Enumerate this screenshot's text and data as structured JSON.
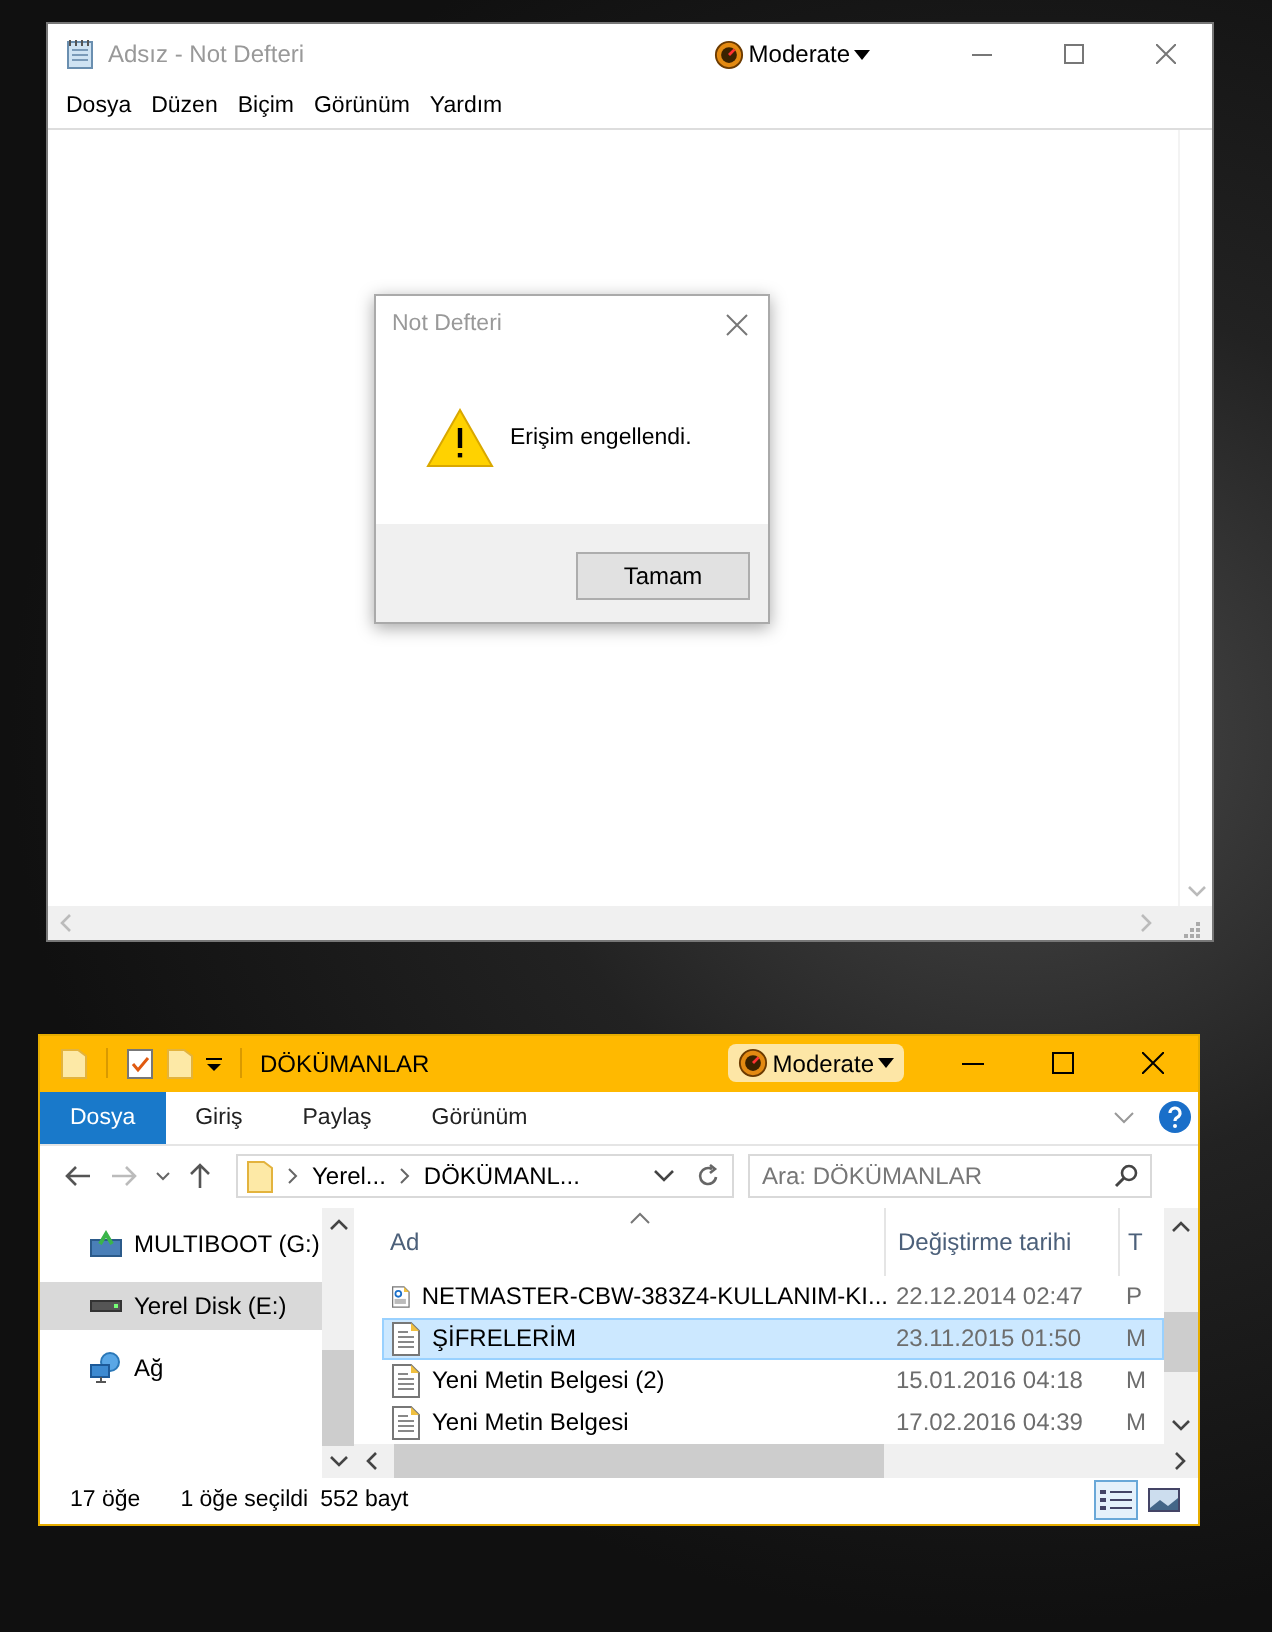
{
  "notepad": {
    "title": "Adsız - Not Defteri",
    "badge": "Moderate",
    "menu": [
      "Dosya",
      "Düzen",
      "Biçim",
      "Görünüm",
      "Yardım"
    ]
  },
  "dialog": {
    "title": "Not Defteri",
    "message": "Erişim engellendi.",
    "button": "Tamam"
  },
  "explorer": {
    "title": "DÖKÜMANLAR",
    "badge": "Moderate",
    "tabs": [
      {
        "label": "Dosya",
        "selected": true
      },
      {
        "label": "Giriş",
        "selected": false
      },
      {
        "label": "Paylaş",
        "selected": false
      },
      {
        "label": "Görünüm",
        "selected": false
      }
    ],
    "breadcrumb": [
      "Yerel...",
      "DÖKÜMANL..."
    ],
    "search": {
      "placeholder": "Ara: DÖKÜMANLAR"
    },
    "nav": [
      {
        "label": "MULTIBOOT (G:)",
        "kind": "usb",
        "selected": false
      },
      {
        "label": "Yerel Disk (E:)",
        "kind": "disk",
        "selected": true
      },
      {
        "label": "Ağ",
        "kind": "network",
        "selected": false
      }
    ],
    "columns": [
      "Ad",
      "Değiştirme tarihi",
      "T"
    ],
    "files": [
      {
        "name": "NETMASTER-CBW-383Z4-KULLANIM-KI...",
        "date": "22.12.2014 02:47",
        "column_3": "P",
        "kind": "pdf",
        "selected": false
      },
      {
        "name": "ŞİFRELERİM",
        "date": "23.11.2015 01:50",
        "column_3": "M",
        "kind": "text",
        "selected": true
      },
      {
        "name": "Yeni Metin Belgesi (2)",
        "date": "15.01.2016 04:18",
        "column_3": "M",
        "kind": "text",
        "selected": false
      },
      {
        "name": "Yeni Metin Belgesi",
        "date": "17.02.2016 04:39",
        "column_3": "M",
        "kind": "text",
        "selected": false
      }
    ],
    "status": {
      "count": "17 öğe",
      "selection": "1 öğe seçildi",
      "size": "552 bayt"
    }
  }
}
